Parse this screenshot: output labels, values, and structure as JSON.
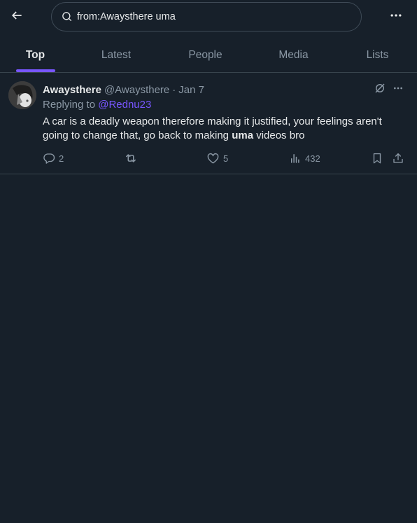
{
  "search": {
    "query": "from:Awaysthere uma"
  },
  "icons": {
    "back": "arrow-left-icon",
    "search": "search-icon",
    "more": "more-horizontal-icon",
    "grok": "grok-icon",
    "reply": "reply-icon",
    "retweet": "retweet-icon",
    "like": "heart-icon",
    "views": "views-chart-icon",
    "bookmark": "bookmark-icon",
    "share": "share-icon"
  },
  "tabs": [
    {
      "label": "Top",
      "active": true
    },
    {
      "label": "Latest",
      "active": false
    },
    {
      "label": "People",
      "active": false
    },
    {
      "label": "Media",
      "active": false
    },
    {
      "label": "Lists",
      "active": false
    }
  ],
  "tweet": {
    "display_name": "Awaysthere",
    "handle": "@Awaysthere",
    "separator": "·",
    "date": "Jan 7",
    "replying_prefix": "Replying to",
    "replying_to": "@Rednu23",
    "text_before": "A car is a deadly weapon therefore making it justified, your feelings aren't going to change that, go back to making ",
    "text_highlight": "uma",
    "text_after": " videos bro",
    "replies": "2",
    "retweets": "",
    "likes": "5",
    "views": "432"
  },
  "colors": {
    "background": "#17202a",
    "accent": "#7856ff",
    "text_primary": "#e7e9ea",
    "text_secondary": "#8b98a5",
    "border": "#38444d"
  }
}
